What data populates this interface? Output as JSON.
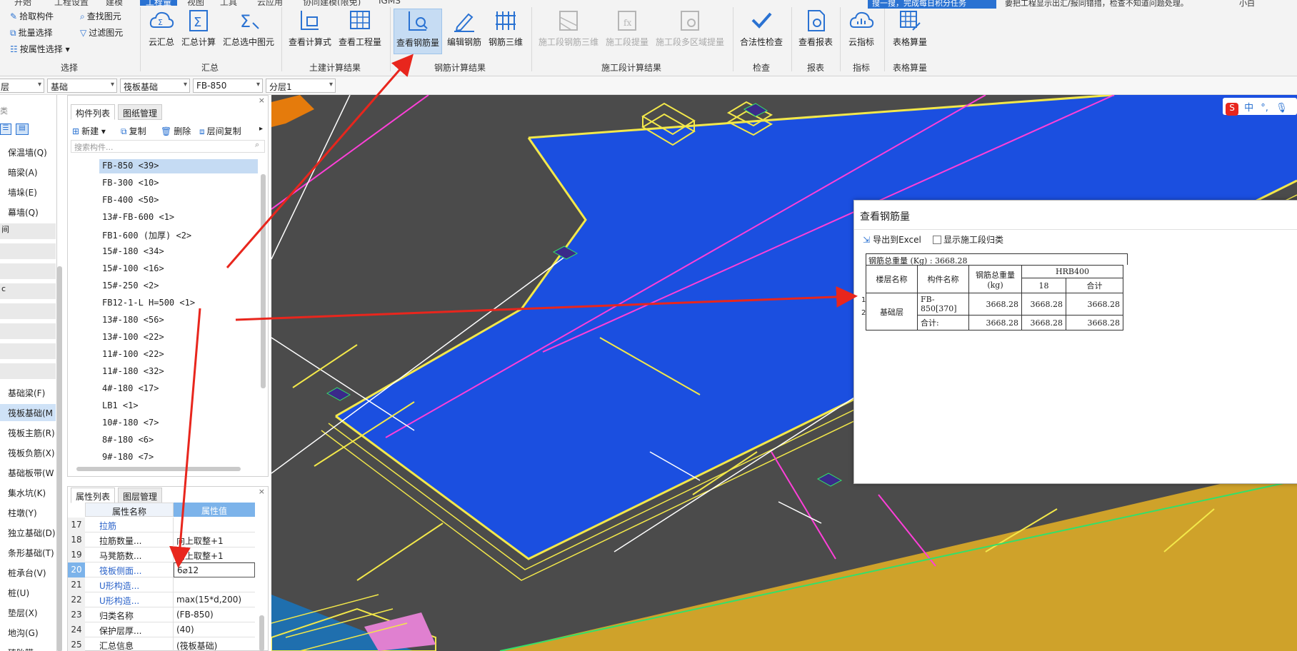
{
  "menu": {
    "tabs": [
      "开始",
      "工程设置",
      "建模",
      "工程量",
      "视图",
      "工具",
      "云应用",
      "协同建模(限免)",
      "IGMS"
    ],
    "active": "工程量"
  },
  "ribbon": {
    "select_group": {
      "label": "选择",
      "items": [
        "拾取构件",
        "批量选择",
        "按属性选择",
        "查找图元",
        "过滤图元"
      ]
    },
    "summary_group": {
      "label": "汇总",
      "buttons": [
        "云汇总",
        "汇总计算",
        "汇总选中图元"
      ]
    },
    "civil_group": {
      "label": "土建计算结果",
      "buttons": [
        "查看计算式",
        "查看工程量"
      ]
    },
    "rebar_group": {
      "label": "钢筋计算结果",
      "buttons": [
        "查看钢筋量",
        "编辑钢筋",
        "钢筋三维"
      ]
    },
    "stage_group": {
      "label": "施工段计算结果",
      "buttons": [
        "施工段钢筋三维",
        "施工段提量",
        "施工段多区域提量"
      ]
    },
    "check_group": {
      "label": "检查",
      "buttons": [
        "合法性检查"
      ]
    },
    "report_group": {
      "label": "报表",
      "buttons": [
        "查看报表"
      ]
    },
    "index_group": {
      "label": "指标",
      "buttons": [
        "云指标"
      ]
    },
    "table_group": {
      "label": "表格算量",
      "buttons": [
        "表格算量"
      ]
    }
  },
  "filterbar": {
    "combos": [
      "层",
      "基础",
      "筏板基础",
      "FB-850",
      "分层1"
    ]
  },
  "leftnav": {
    "header": "类",
    "items": [
      {
        "label": "保温墙(Q)",
        "sel": false
      },
      {
        "label": "暗梁(A)",
        "sel": false
      },
      {
        "label": "墙垛(E)",
        "sel": false
      },
      {
        "label": "幕墙(Q)",
        "sel": false
      },
      {
        "label": "基础梁(F)",
        "sel": false
      },
      {
        "label": "筏板基础(M",
        "sel": true
      },
      {
        "label": "筏板主筋(R)",
        "sel": false
      },
      {
        "label": "筏板负筋(X)",
        "sel": false
      },
      {
        "label": "基础板带(W",
        "sel": false
      },
      {
        "label": "集水坑(K)",
        "sel": false
      },
      {
        "label": "柱墩(Y)",
        "sel": false
      },
      {
        "label": "独立基础(D)",
        "sel": false
      },
      {
        "label": "条形基础(T)",
        "sel": false
      },
      {
        "label": "桩承台(V)",
        "sel": false
      },
      {
        "label": "桩(U)",
        "sel": false
      },
      {
        "label": "垫层(X)",
        "sel": false
      },
      {
        "label": "地沟(G)",
        "sel": false
      },
      {
        "label": "砖胎膜",
        "sel": false
      }
    ],
    "partial_1": "间",
    "partial_2": "c"
  },
  "comppanel": {
    "tabs": [
      "构件列表",
      "图纸管理"
    ],
    "tools": [
      "新建",
      "复制",
      "删除",
      "层间复制"
    ],
    "search_placeholder": "搜索构件...",
    "items": [
      "FB-850 <39>",
      "FB-300 <10>",
      "FB-400 <50>",
      "13#-FB-600 <1>",
      "FB1-600 (加厚) <2>",
      "15#-180 <34>",
      "15#-100 <16>",
      "15#-250 <2>",
      "FB12-1-L H=500 <1>",
      "13#-180 <56>",
      "13#-100 <22>",
      "11#-100 <22>",
      "11#-180 <32>",
      "4#-180 <17>",
      "LB1 <1>",
      "10#-180 <7>",
      "8#-180 <6>",
      "9#-180 <7>"
    ]
  },
  "proppanel": {
    "tabs": [
      "属性列表",
      "图层管理"
    ],
    "headers": [
      "属性名称",
      "属性值"
    ],
    "rows": [
      {
        "num": "17",
        "name": "拉筋",
        "value": "",
        "blue": true
      },
      {
        "num": "18",
        "name": "拉筋数量...",
        "value": "向上取整+1",
        "blue": false
      },
      {
        "num": "19",
        "name": "马凳筋数...",
        "value": "向上取整+1",
        "blue": false
      },
      {
        "num": "20",
        "name": "筏板侧面...",
        "value": "6⌀12",
        "blue": true
      },
      {
        "num": "21",
        "name": "U形构造...",
        "value": "",
        "blue": true
      },
      {
        "num": "22",
        "name": "U形构造...",
        "value": "max(15*d,200)",
        "blue": true
      },
      {
        "num": "23",
        "name": "归类名称",
        "value": "(FB-850)",
        "blue": false
      },
      {
        "num": "24",
        "name": "保护层厚...",
        "value": "(40)",
        "blue": false
      },
      {
        "num": "25",
        "name": "汇总信息",
        "value": "(筏板基础)",
        "blue": false
      }
    ]
  },
  "dialog": {
    "title": "查看钢筋量",
    "export_label": "导出到Excel",
    "show_stage_label": "显示施工段归类",
    "total_line": "钢筋总重量 (Kg) : 3668.28",
    "headers": {
      "floor": "楼层名称",
      "comp": "构件名称",
      "total": "钢筋总重量(kg)",
      "grade": "HRB400",
      "dia": "18",
      "sum": "合计"
    },
    "rows": [
      {
        "idx": "1",
        "floor": "基础层",
        "comp": "FB-850[370]",
        "total": "3668.28",
        "dia": "3668.28",
        "sum": "3668.28"
      },
      {
        "idx": "2",
        "floor": "",
        "comp": "合计:",
        "total": "3668.28",
        "dia": "3668.28",
        "sum": "3668.28"
      }
    ]
  },
  "topnote": {
    "blue_text": "搜一搜，完成每日积分任务",
    "gray_text": "要把工程显示出汇/报同错措，检查不知道问题处理。",
    "right_text": "小白"
  },
  "ime": {
    "label": "中"
  },
  "colors": {
    "accent": "#2a72d2",
    "arrow": "#e8261d",
    "slab": "#1b4fe0",
    "viewport": "#4b4b4b"
  }
}
